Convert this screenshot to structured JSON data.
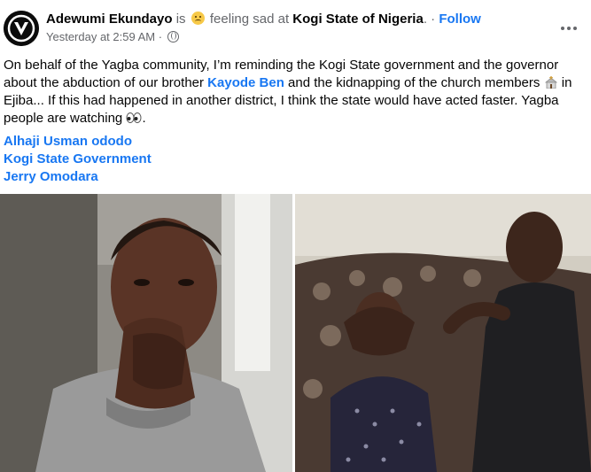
{
  "post": {
    "author": "Adewumi Ekundayo",
    "is_text": "is",
    "feeling_text": "feeling sad at",
    "location": "Kogi State of Nigeria",
    "separator": ".",
    "dot": "·",
    "follow_label": "Follow",
    "timestamp": "Yesterday at 2:59 AM",
    "time_dot": "·",
    "body": {
      "part1": "On behalf of the Yagba community, I’m reminding the Kogi State government and the governor about the abduction of our brother ",
      "mention": "Kayode Ben",
      "part2": " and the kidnapping of the church members ",
      "part3": " in Ejiba... If this had happened in another district, I think the state would have acted faster. Yagba people are watching ",
      "part4": "."
    },
    "tags": [
      "Alhaji Usman ododo",
      "Kogi State Government",
      "Jerry Omodara"
    ]
  },
  "icons": {
    "avatar": "avatar-logo-icon",
    "emoji": "sad-face-icon",
    "privacy": "globe-icon",
    "menu": "more-options-icon",
    "church": "church-icon",
    "eyes": "eyes-icon"
  },
  "colors": {
    "link": "#1877f2",
    "text": "#050505",
    "muted": "#65676b"
  }
}
